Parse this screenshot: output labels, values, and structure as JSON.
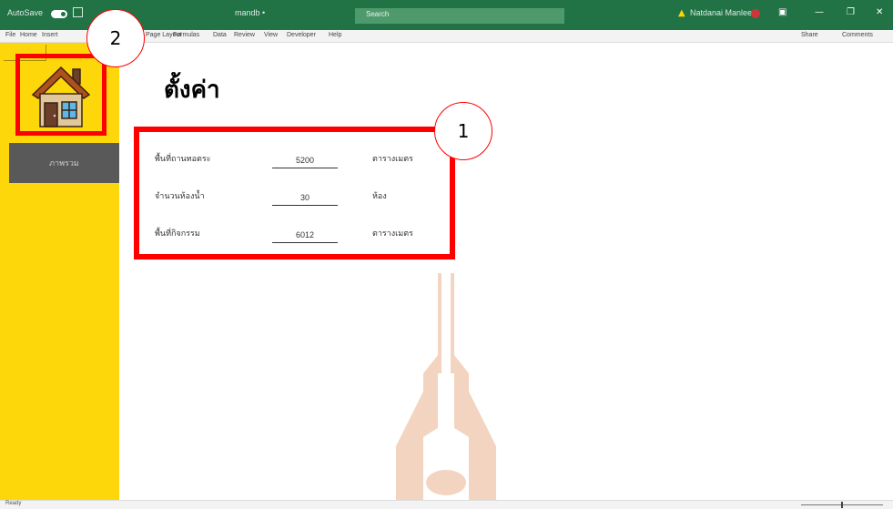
{
  "titlebar": {
    "autosave": "AutoSave",
    "filename": "mandb •",
    "search_placeholder": "Search",
    "user_name": "Natdanai Manlee",
    "minimize": "—",
    "restore": "❐",
    "close": "✕"
  },
  "menu": {
    "items": [
      "File",
      "Home",
      "Insert",
      "Page Layout",
      "Formulas",
      "Data",
      "Review",
      "View",
      "Developer",
      "Help"
    ],
    "share": "Share",
    "comments": "Comments"
  },
  "sidebar": {
    "nav_label": "ภาพรวม"
  },
  "main": {
    "title": "ตั้งค่า",
    "rows": [
      {
        "label": "พื้นที่ถานทอตระ",
        "value": "5200",
        "unit": "ตารางเมตร"
      },
      {
        "label": "จำนวนห้องน้ำ",
        "value": "30",
        "unit": "ห้อง"
      },
      {
        "label": "พื้นที่กิจกรรม",
        "value": "6012",
        "unit": "ตารางเมตร"
      }
    ]
  },
  "callouts": {
    "settings": "1",
    "home": "2"
  },
  "statusbar": {
    "ready": "Ready"
  },
  "colors": {
    "titlebar": "#217346",
    "sidebar": "#FDD70A",
    "nav_button": "#595959",
    "highlight": "#FF0000"
  }
}
